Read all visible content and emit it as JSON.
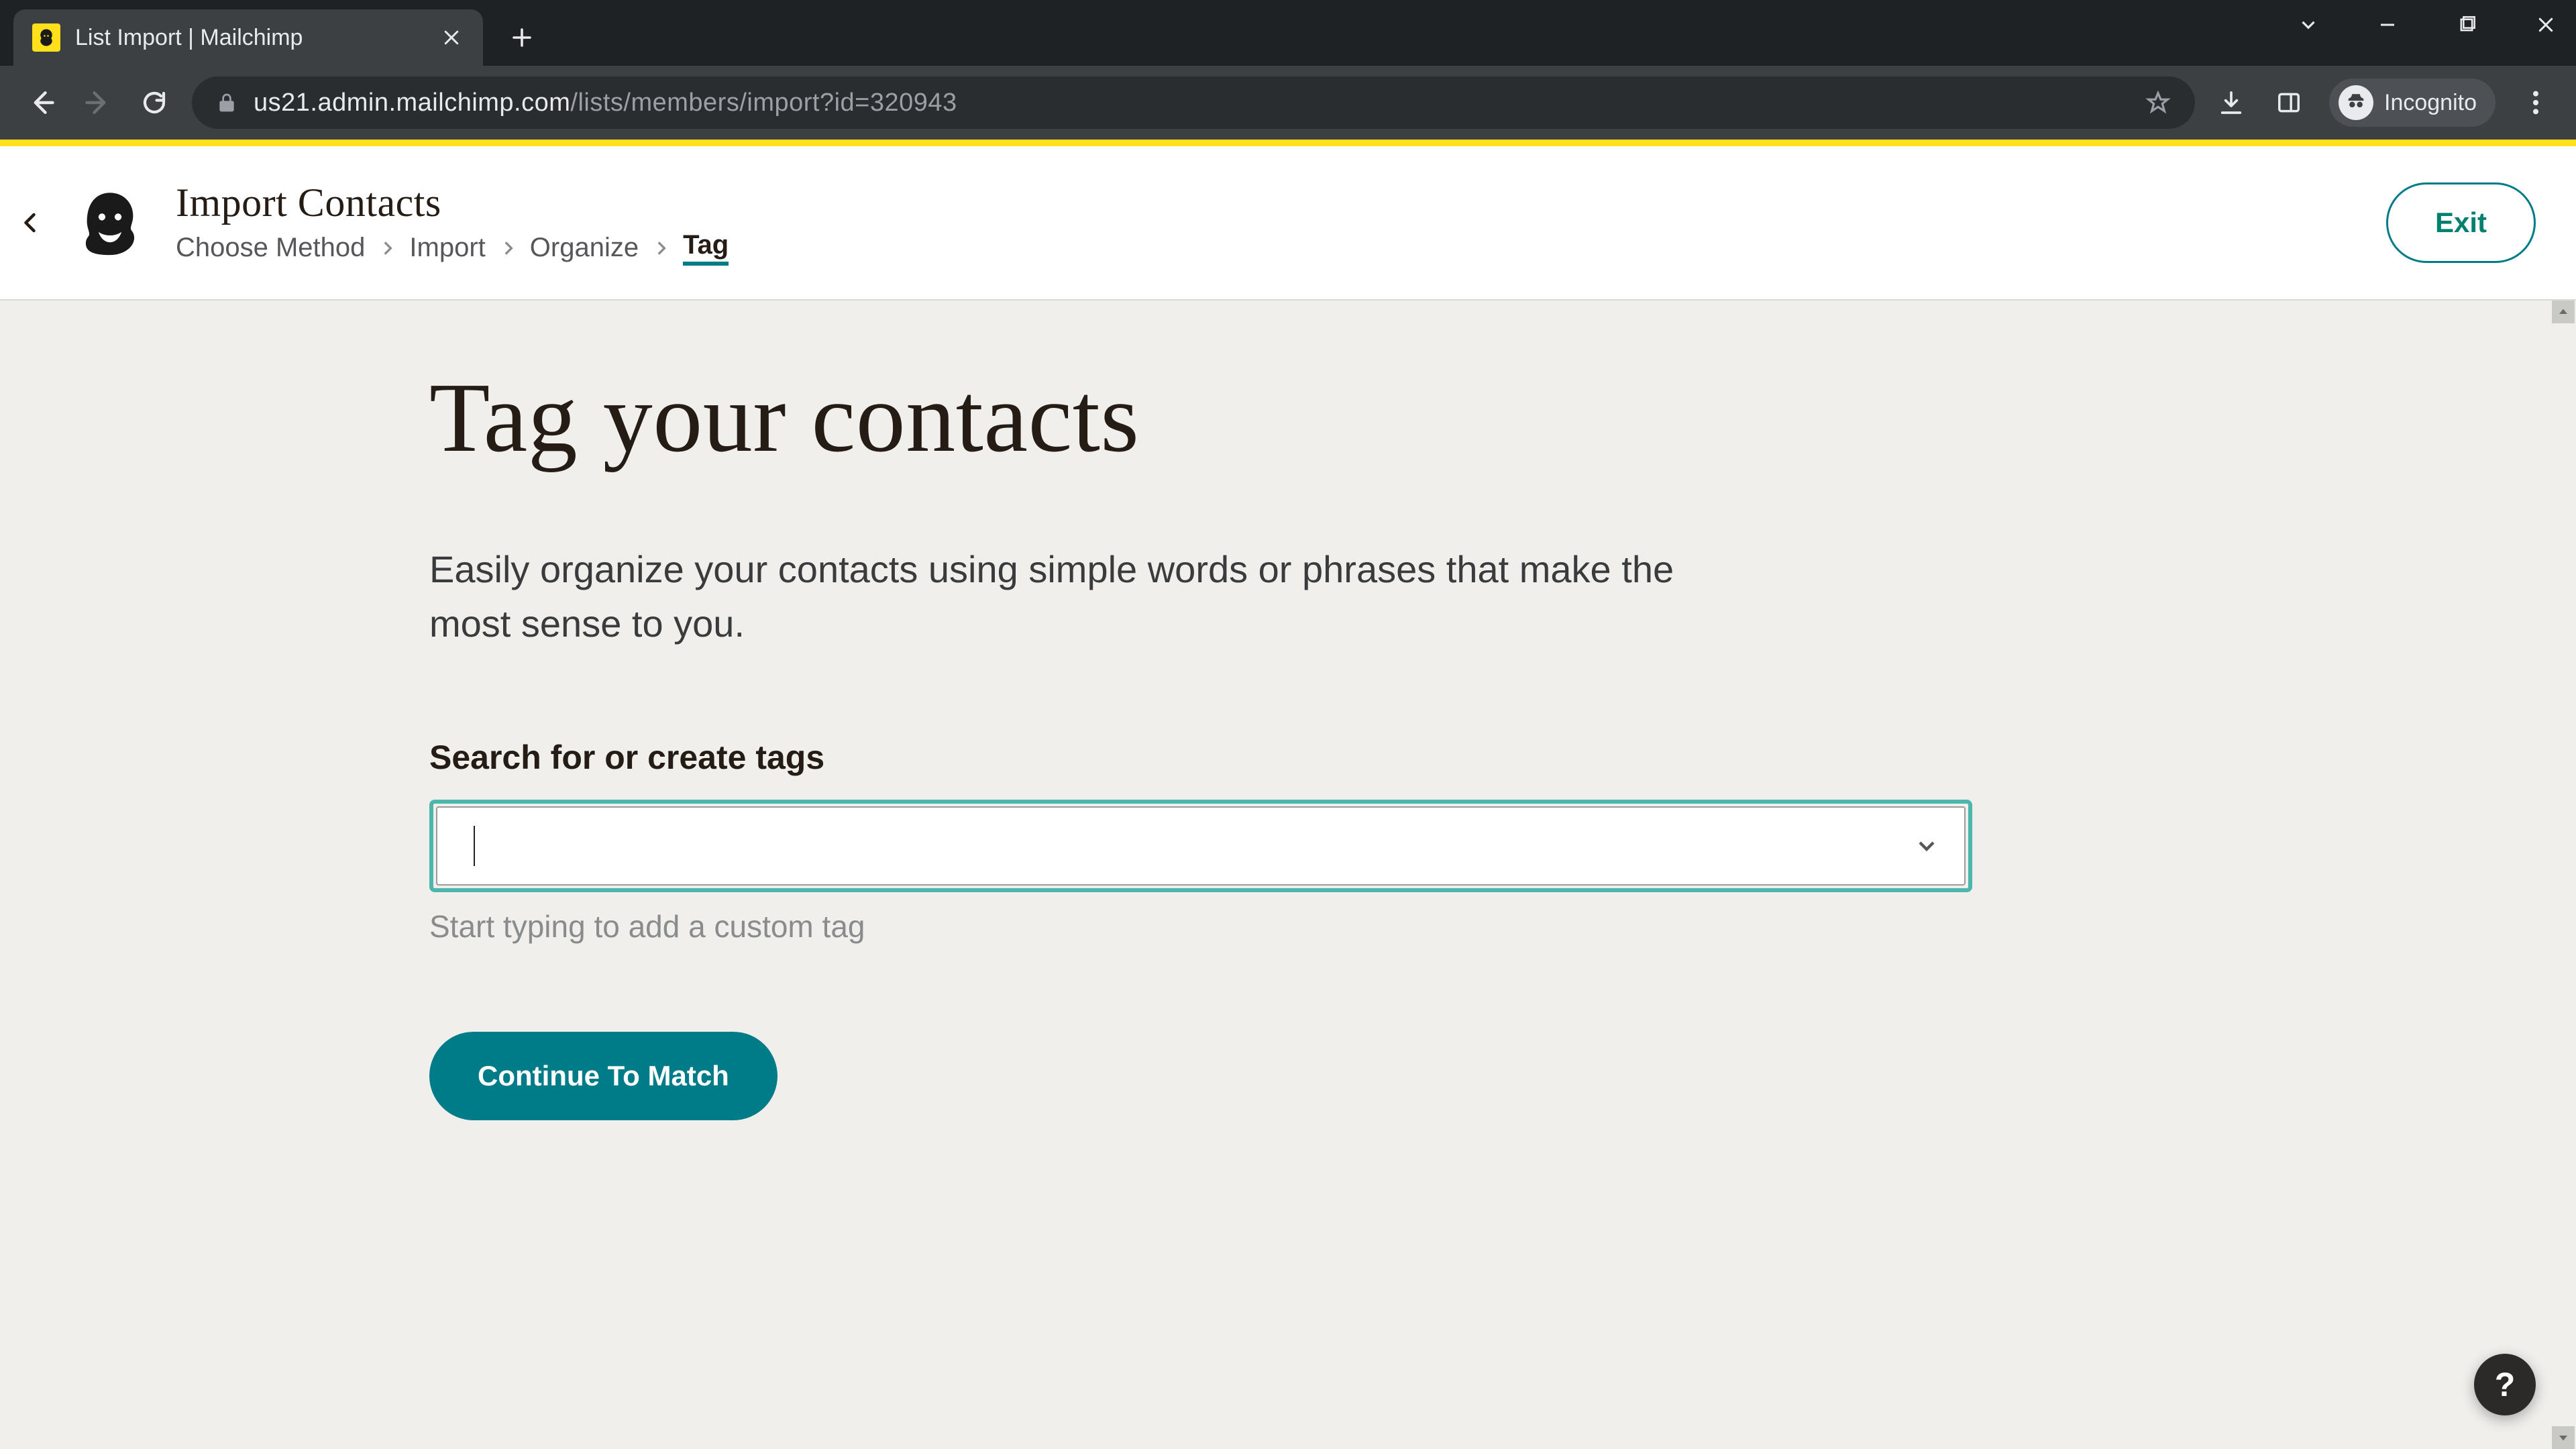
{
  "browser": {
    "tab_title": "List Import | Mailchimp",
    "url_host": "us21.admin.mailchimp.com",
    "url_path": "/lists/members/import?id=320943",
    "incognito_label": "Incognito"
  },
  "header": {
    "title": "Import Contacts",
    "breadcrumb": [
      "Choose Method",
      "Import",
      "Organize",
      "Tag"
    ],
    "active_crumb_index": 3,
    "exit_label": "Exit"
  },
  "main": {
    "page_title": "Tag your contacts",
    "lead": "Easily organize your contacts using simple words or phrases that make the most sense to you.",
    "field_label": "Search for or create tags",
    "tag_input_value": "",
    "tag_input_placeholder": "",
    "hint": "Start typing to add a custom tag",
    "cta_label": "Continue To Match"
  },
  "help": {
    "label": "?"
  }
}
